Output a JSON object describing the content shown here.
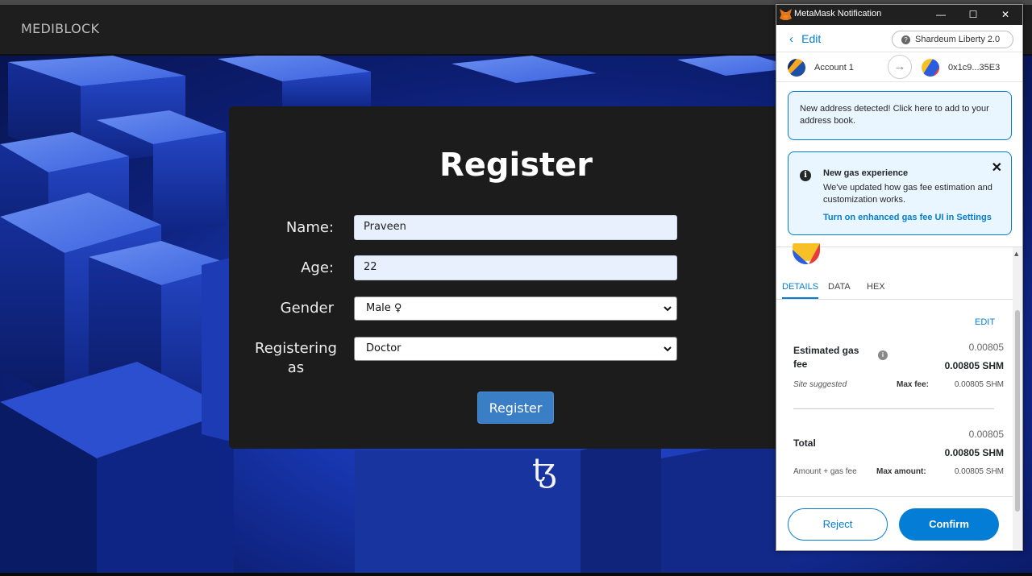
{
  "app": {
    "brand": "MEDIBLOCK"
  },
  "register": {
    "title": "Register",
    "name_label": "Name:",
    "name_value": "Praveen",
    "age_label": "Age:",
    "age_value": "22",
    "gender_label": "Gender",
    "gender_value": "Male ♀",
    "role_label_line1": "Registering",
    "role_label_line2": "as",
    "role_value": "Doctor",
    "submit_label": "Register"
  },
  "background": {
    "logo_glyph": "ꜩ"
  },
  "metamask": {
    "window_title": "MetaMask Notification",
    "back_label": "Edit",
    "network": "Shardeum Liberty 2.0",
    "from_account": "Account 1",
    "to_address": "0x1c9...35E3",
    "notice_address": "New address detected! Click here to add to your address book.",
    "notice_gas_title": "New gas experience",
    "notice_gas_body": "We've updated how gas fee estimation and customization works.",
    "notice_gas_link": "Turn on enhanced gas fee UI in Settings",
    "tabs": [
      "DETAILS",
      "DATA",
      "HEX"
    ],
    "edit_link": "EDIT",
    "gas_label_line1": "Estimated gas",
    "gas_label_line2": "fee",
    "gas_value_small": "0.00805",
    "gas_value": "0.00805 SHM",
    "site_suggested": "Site suggested",
    "max_fee_label": "Max fee:",
    "max_fee_value": "0.00805 SHM",
    "total_label": "Total",
    "total_small": "0.00805",
    "total_value": "0.00805 SHM",
    "amount_gas_label": "Amount + gas fee",
    "max_amount_label": "Max amount:",
    "max_amount_value": "0.00805 SHM",
    "reject_label": "Reject",
    "confirm_label": "Confirm"
  },
  "colors": {
    "accent": "#037dd6",
    "register_button": "#3a7ec6",
    "card_bg": "#1c1c1c"
  },
  "icons": [
    "metamask-fox-icon",
    "minimize-icon",
    "maximize-icon",
    "close-icon",
    "chevron-left-icon",
    "question-icon",
    "arrow-right-icon",
    "info-icon",
    "tezos-logo"
  ]
}
